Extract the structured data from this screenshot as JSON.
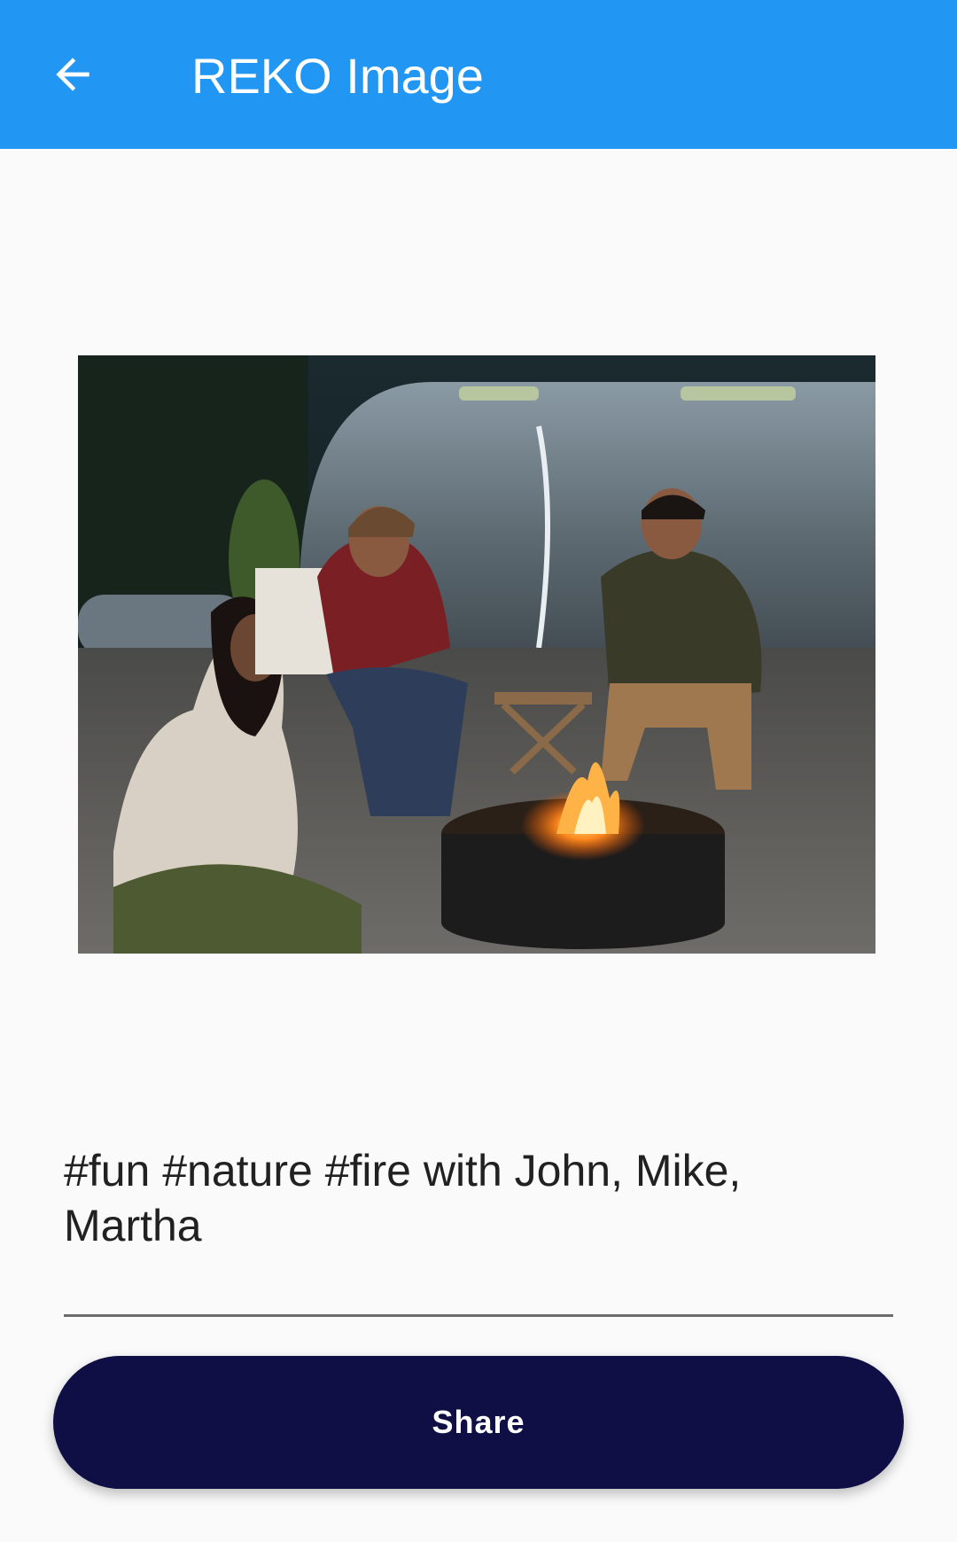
{
  "app_bar": {
    "title": "REKO Image",
    "back_icon": "arrow-left-icon",
    "background": "#2196f3"
  },
  "photo": {
    "subject": "photo"
  },
  "caption": {
    "value": "#fun #nature #fire with John, Mike,\nMartha"
  },
  "share_button": {
    "label": "Share",
    "background": "#0f0f45"
  }
}
